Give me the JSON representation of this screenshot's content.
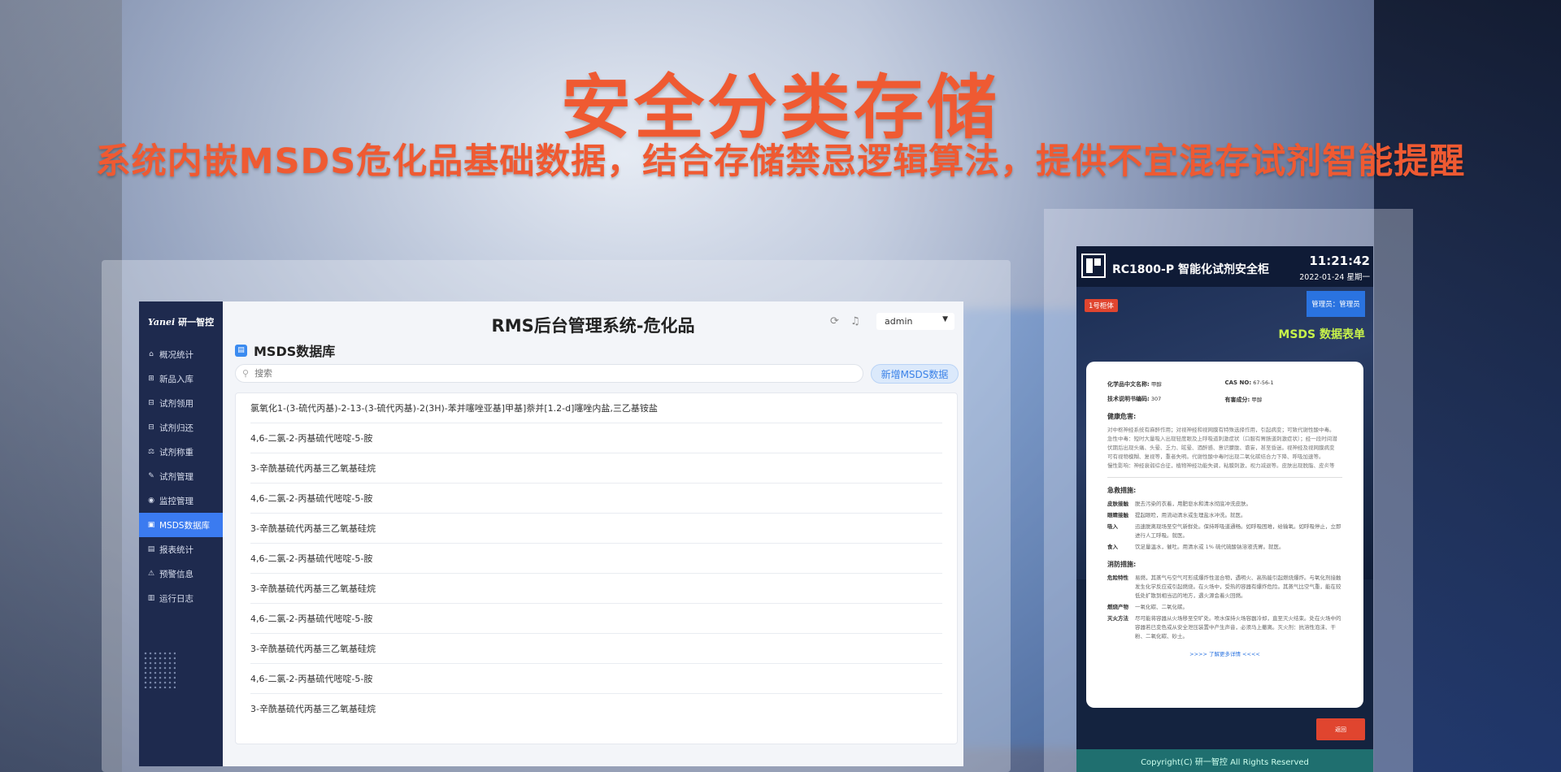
{
  "headline": {
    "title": "安全分类存储",
    "subtitle": "系统内嵌MSDS危化品基础数据，结合存储禁忌逻辑算法，提供不宜混存试剂智能提醒"
  },
  "app": {
    "logo_brand": "Yanei",
    "logo_text": "研一智控",
    "title": "RMS后台管理系统-危化品",
    "user": "admin",
    "sidebar": [
      {
        "label": "概况统计",
        "icon": "home-icon",
        "glyph": "⌂"
      },
      {
        "label": "新品入库",
        "icon": "inbox-icon",
        "glyph": "⊞"
      },
      {
        "label": "试剂领用",
        "icon": "checkout-icon",
        "glyph": "⊟"
      },
      {
        "label": "试剂归还",
        "icon": "return-icon",
        "glyph": "⊟"
      },
      {
        "label": "试剂称重",
        "icon": "scale-icon",
        "glyph": "⚖"
      },
      {
        "label": "试剂管理",
        "icon": "edit-icon",
        "glyph": "✎"
      },
      {
        "label": "监控管理",
        "icon": "camera-icon",
        "glyph": "◉"
      },
      {
        "label": "MSDS数据库",
        "icon": "database-icon",
        "glyph": "▣"
      },
      {
        "label": "报表统计",
        "icon": "report-icon",
        "glyph": "▤"
      },
      {
        "label": "预警信息",
        "icon": "warning-icon",
        "glyph": "⚠"
      },
      {
        "label": "运行日志",
        "icon": "log-icon",
        "glyph": "▥"
      }
    ],
    "active_index": 7,
    "page_title": "MSDS数据库",
    "search_placeholder": "搜索",
    "add_button": "新增MSDS数据",
    "rows": [
      "氯氧化1-(3-硫代丙基)-2-13-(3-硫代丙基)-2(3H)-苯并噻唑亚基]甲基]萘并[1.2-d]噻唑内盐,三乙基铵盐",
      "4,6-二氯-2-丙基硫代嘧啶-5-胺",
      "3-辛酰基硫代丙基三乙氧基硅烷",
      "4,6-二氯-2-丙基硫代嘧啶-5-胺",
      "3-辛酰基硫代丙基三乙氧基硅烷",
      "4,6-二氯-2-丙基硫代嘧啶-5-胺",
      "3-辛酰基硫代丙基三乙氧基硅烷",
      "4,6-二氯-2-丙基硫代嘧啶-5-胺",
      "3-辛酰基硫代丙基三乙氧基硅烷",
      "4,6-二氯-2-丙基硫代嘧啶-5-胺",
      "3-辛酰基硫代丙基三乙氧基硅烷"
    ]
  },
  "device": {
    "name": "RC1800-P 智能化试剂安全柜",
    "time": "11:21:42",
    "date": "2022-01-24 星期一",
    "cabinet_tag": "1号柜体",
    "admin_label": "管理员：管理员",
    "form_title": "MSDS 数据表单",
    "sheet": {
      "cn_name_label": "化学品中文名称:",
      "cn_name": "甲醇",
      "cas_label": "CAS NO:",
      "cas": "67-56-1",
      "doc_label": "技术说明书编码:",
      "doc": "307",
      "harm_label": "有害成分:",
      "harm": "甲醇",
      "health_title": "健康危害:",
      "health_text": [
        "对中枢神经系统有麻醉作用；对视神经和视网膜有特殊选择作用，引起病变；可致代谢性酸中毒。",
        "急性中毒：短时大量吸入出现轻度眼及上呼吸道刺激症状（口服有胃肠道刺激症状）；经一段时间潜",
        "伏期后出现头痛、头晕、乏力、眩晕、酒醉感、意识朦胧、谵妄，甚至昏迷。视神经及视网膜病变",
        "可有视物模糊、复视等，重者失明。代谢性酸中毒时出现二氧化碳结合力下降、呼吸加速等。",
        "慢性影响：神经衰弱综合征，植物神经功能失调，粘膜刺激，视力减退等。皮肤出现脱脂、皮炎等"
      ],
      "firstaid_title": "急救措施:",
      "firstaid": [
        {
          "k": "皮肤接触",
          "v": "脱去污染的衣着，用肥皂水和清水彻底冲洗皮肤。"
        },
        {
          "k": "眼睛接触",
          "v": "提起眼睑，用流动清水或生理盐水冲洗。就医。"
        },
        {
          "k": "吸入",
          "v": "迅速脱离现场至空气新鲜处。保持呼吸道通畅。如呼吸困难，给输氧。如呼吸停止，立即进行人工呼吸。就医。"
        },
        {
          "k": "食入",
          "v": "饮足量温水，催吐。用清水或 1% 硫代硫酸钠溶液洗胃。就医。"
        }
      ],
      "fire_title": "消防措施:",
      "fire": [
        {
          "k": "危险特性",
          "v": "易燃，其蒸气与空气可形成爆炸性混合物，遇明火、高热能引起燃烧爆炸。与氧化剂接触发生化学反应或引起燃烧。在火场中，受热的容器有爆炸危险。其蒸气比空气重，能在较低处扩散到相当远的地方，遇火源会着火回燃。"
        },
        {
          "k": "燃烧产物",
          "v": "一氧化碳、二氧化碳。"
        },
        {
          "k": "灭火方法",
          "v": "尽可能将容器从火场移至空旷处。喷水保持火场容器冷却，直至灭火结束。处在火场中的容器若已变色或从安全泄压装置中产生声音，必须马上撤离。灭火剂：抗溶性泡沫、干粉、二氧化碳、砂土。"
        }
      ],
      "more_link": ">>>> 了解更多详情 <<<<"
    },
    "return_button": "返回",
    "footer": "Copyright(C) 研一智控 All Rights Reserved"
  }
}
